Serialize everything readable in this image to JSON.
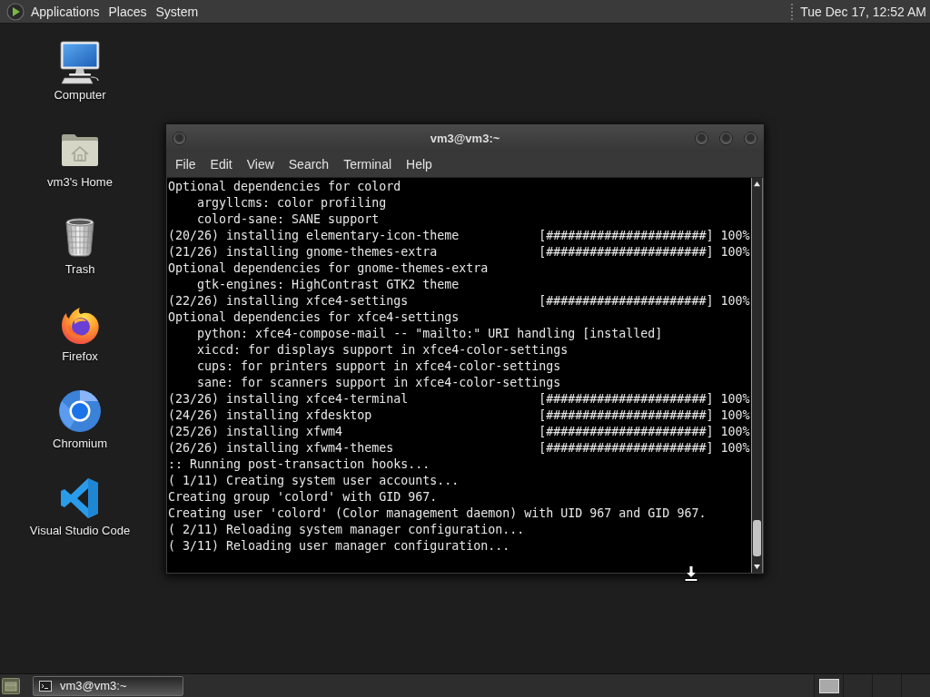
{
  "top_panel": {
    "menus": [
      "Applications",
      "Places",
      "System"
    ],
    "clock": "Tue Dec 17, 12:52 AM"
  },
  "desktop_icons": [
    {
      "label": "Computer",
      "kind": "monitor"
    },
    {
      "label": "vm3's Home",
      "kind": "home-folder"
    },
    {
      "label": "Trash",
      "kind": "bin"
    },
    {
      "label": "Firefox",
      "kind": "fox"
    },
    {
      "label": "Chromium",
      "kind": "ring"
    },
    {
      "label": "Visual Studio Code",
      "kind": "ribbon"
    }
  ],
  "window": {
    "title": "vm3@vm3:~",
    "menu": [
      "File",
      "Edit",
      "View",
      "Search",
      "Terminal",
      "Help"
    ],
    "lines": [
      {
        "kind": "text",
        "text": "Optional dependencies for colord",
        "children": [
          {
            "kind": "text",
            "text": "argyllcms: color profiling"
          },
          {
            "kind": "text",
            "text": "colord-sane: SANE support"
          }
        ]
      },
      {
        "kind": "progress",
        "text": "(20/26) installing elementary-icon-theme",
        "bar": "[######################]",
        "percent": "100%"
      },
      {
        "kind": "progress",
        "text": "(21/26) installing gnome-themes-extra",
        "bar": "[######################]",
        "percent": "100%"
      },
      {
        "kind": "text",
        "text": "Optional dependencies for gnome-themes-extra",
        "children": [
          {
            "kind": "text",
            "text": "gtk-engines: HighContrast GTK2 theme"
          }
        ]
      },
      {
        "kind": "progress",
        "text": "(22/26) installing xfce4-settings",
        "bar": "[######################]",
        "percent": "100%"
      },
      {
        "kind": "text",
        "text": "Optional dependencies for xfce4-settings",
        "children": [
          {
            "kind": "text",
            "text": "python: xfce4-compose-mail -- \"mailto:\" URI handling [installed]"
          },
          {
            "kind": "text",
            "text": "xiccd: for displays support in xfce4-color-settings"
          },
          {
            "kind": "text",
            "text": "cups: for printers support in xfce4-color-settings"
          },
          {
            "kind": "text",
            "text": "sane: for scanners support in xfce4-color-settings"
          }
        ]
      },
      {
        "kind": "progress",
        "text": "(23/26) installing xfce4-terminal",
        "bar": "[######################]",
        "percent": "100%"
      },
      {
        "kind": "progress",
        "text": "(24/26) installing xfdesktop",
        "bar": "[######################]",
        "percent": "100%"
      },
      {
        "kind": "progress",
        "text": "(25/26) installing xfwm4",
        "bar": "[######################]",
        "percent": "100%"
      },
      {
        "kind": "progress",
        "text": "(26/26) installing xfwm4-themes",
        "bar": "[######################]",
        "percent": "100%"
      },
      {
        "kind": "text",
        "text": ":: Running post-transaction hooks..."
      },
      {
        "kind": "text",
        "text": "( 1/11) Creating system user accounts..."
      },
      {
        "kind": "text",
        "text": "Creating group 'colord' with GID 967."
      },
      {
        "kind": "text",
        "text": "Creating user 'colord' (Color management daemon) with UID 967 and GID 967."
      },
      {
        "kind": "text",
        "text": "( 2/11) Reloading system manager configuration..."
      },
      {
        "kind": "text",
        "text": "( 3/11) Reloading user manager configuration..."
      }
    ]
  },
  "taskbar": {
    "tasks": [
      {
        "label": "vm3@vm3:~",
        "selected": true
      }
    ]
  }
}
